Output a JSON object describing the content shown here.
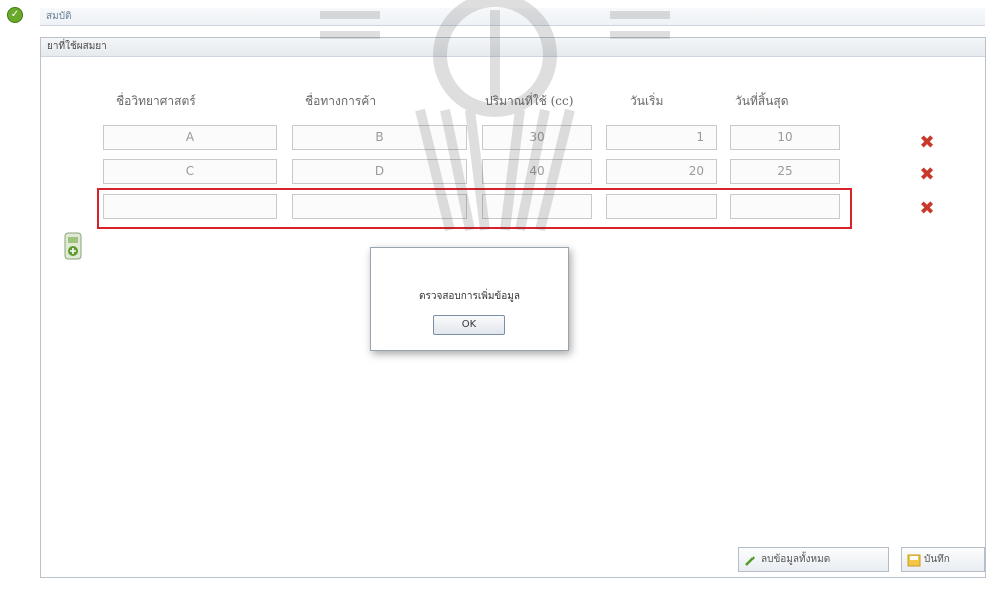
{
  "window": {
    "title": "สมบัติ"
  },
  "panel": {
    "title": "ยาที่ใช้ผสมยา"
  },
  "columns": [
    "ชื่อวิทยาศาสตร์",
    "ชื่อทางการค้า",
    "ปริมาณที่ใช้ (cc)",
    "วันเริ่ม",
    "วันที่สิ้นสุด"
  ],
  "rows": [
    [
      "A",
      "B",
      "30",
      "1",
      "10"
    ],
    [
      "C",
      "D",
      "40",
      "20",
      "25"
    ],
    [
      "",
      "",
      "",
      "",
      ""
    ]
  ],
  "dialog": {
    "message": "ตรวจสอบการเพิ่มข้อมูล",
    "ok_label": "OK"
  },
  "buttons": {
    "delete_all": "ลบข้อมูลทั้งหมด",
    "save": "บันทึก"
  },
  "colors": {
    "highlight": "#d8222a",
    "delete": "#c8392b",
    "accent": "#6aaa2a"
  },
  "icons": [
    "app-icon",
    "delete-row-icon",
    "add-row-icon",
    "delete-all-icon",
    "save-icon"
  ]
}
